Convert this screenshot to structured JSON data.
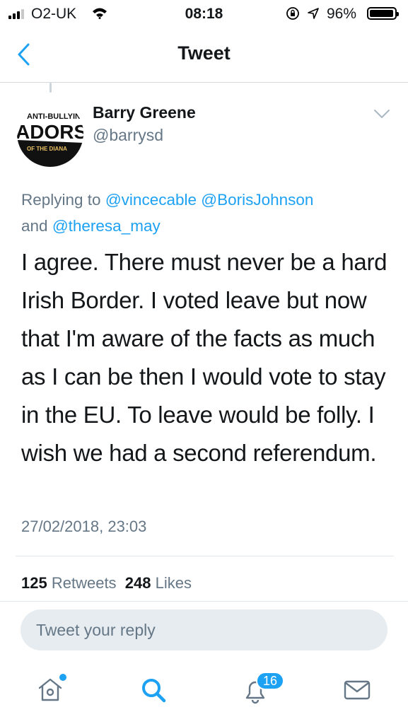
{
  "status_bar": {
    "carrier": "O2-UK",
    "time": "08:18",
    "battery": "96%"
  },
  "nav": {
    "title": "Tweet"
  },
  "tweet": {
    "author_name": "Barry Greene",
    "author_handle": "@barrysd",
    "avatar_text": [
      "ANTI-BULLYIN",
      "ADORS",
      "OF THE DIANA"
    ],
    "replying_prefix": "Replying to",
    "mentions": [
      "@vincecable",
      "@BorisJohnson",
      "@theresa_may"
    ],
    "replying_and": "and",
    "text": "I agree. There must never be a hard Irish Border. I voted leave but now that I'm aware of the facts as much as I can be then I would vote to stay in the EU. To leave would be folly. I wish we had a second referendum.",
    "timestamp": "27/02/2018, 23:03",
    "retweets_count": "125",
    "retweets_label": "Retweets",
    "likes_count": "248",
    "likes_label": "Likes"
  },
  "reply": {
    "placeholder": "Tweet your reply"
  },
  "tab_bar": {
    "notifications_badge": "16",
    "accent": "#1da1f2"
  }
}
